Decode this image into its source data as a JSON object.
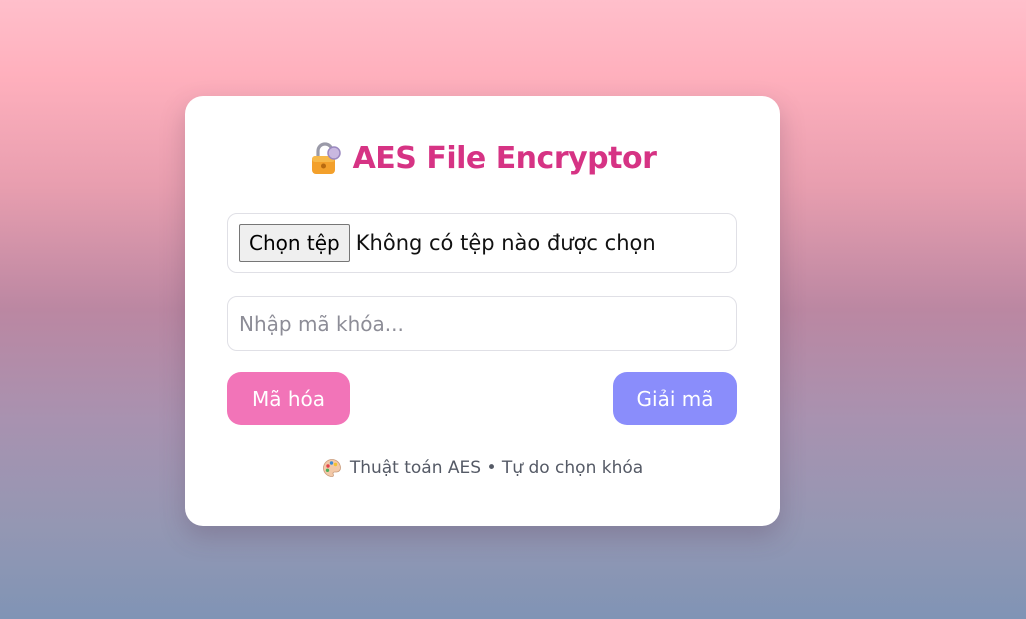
{
  "app": {
    "title": "AES File Encryptor",
    "title_icon": "lock-icon",
    "accent_color": "#d63384"
  },
  "file_picker": {
    "button_label": "Chọn tệp",
    "status": "Không có tệp nào được chọn"
  },
  "key_input": {
    "placeholder": "Nhập mã khóa...",
    "value": ""
  },
  "actions": {
    "encrypt_label": "Mã hóa",
    "encrypt_color": "#f274b8",
    "decrypt_label": "Giải mã",
    "decrypt_color": "#8a8dfb"
  },
  "footer": {
    "icon": "palette-icon",
    "text": "Thuật toán AES • Tự do chọn khóa"
  }
}
